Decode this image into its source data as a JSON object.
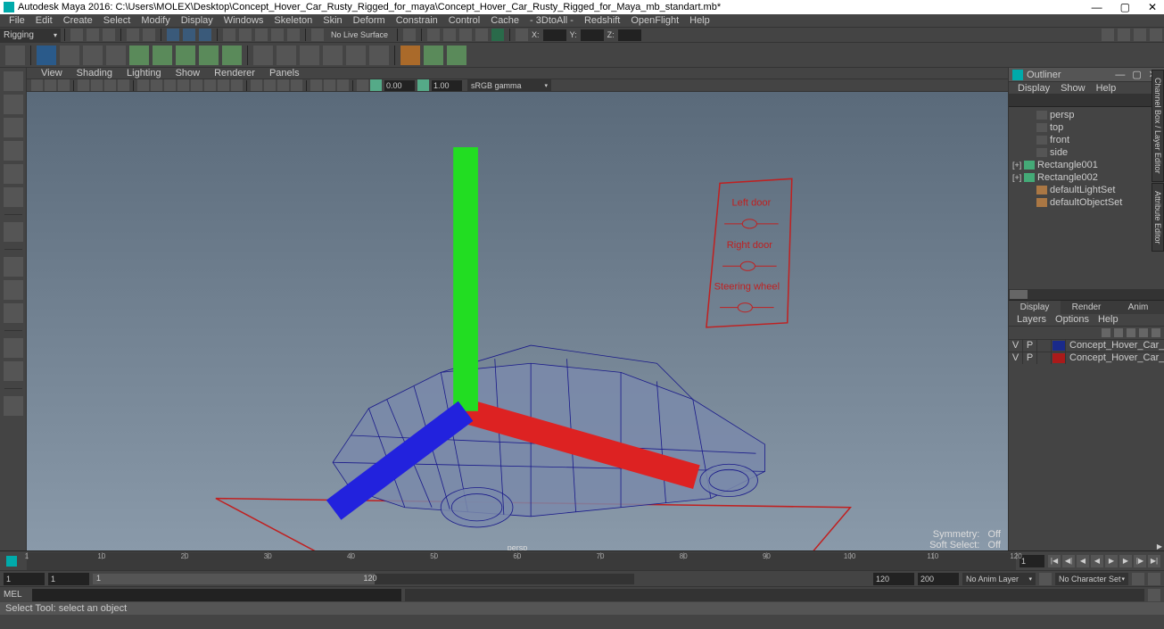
{
  "app": {
    "title": "Autodesk Maya 2016: C:\\Users\\MOLEX\\Desktop\\Concept_Hover_Car_Rusty_Rigged_for_maya\\Concept_Hover_Car_Rusty_Rigged_for_Maya_mb_standart.mb*"
  },
  "menubar": [
    "File",
    "Edit",
    "Create",
    "Select",
    "Modify",
    "Display",
    "Windows",
    "Skeleton",
    "Skin",
    "Deform",
    "Constrain",
    "Control",
    "Cache",
    "- 3DtoAll -",
    "Redshift",
    "OpenFlight",
    "Help"
  ],
  "shelf": {
    "mode": "Rigging",
    "status_label": "No Live Surface",
    "coords": {
      "x_label": "X:",
      "y_label": "Y:",
      "z_label": "Z:"
    }
  },
  "panel_menu": [
    "View",
    "Shading",
    "Lighting",
    "Show",
    "Renderer",
    "Panels"
  ],
  "panel": {
    "field1": "0.00",
    "field2": "1.00",
    "colorspace": "sRGB gamma"
  },
  "viewport": {
    "camera": "persp",
    "symmetry_label": "Symmetry:",
    "symmetry_value": "Off",
    "softsel_label": "Soft Select:",
    "softsel_value": "Off",
    "control_labels": [
      "Left door",
      "Right door",
      "Steering wheel"
    ]
  },
  "outliner": {
    "title": "Outliner",
    "menu": [
      "Display",
      "Show",
      "Help"
    ],
    "items": [
      {
        "type": "cam",
        "label": "persp",
        "indent": 1
      },
      {
        "type": "cam",
        "label": "top",
        "indent": 1
      },
      {
        "type": "cam",
        "label": "front",
        "indent": 1
      },
      {
        "type": "cam",
        "label": "side",
        "indent": 1
      },
      {
        "type": "obj",
        "label": "Rectangle001",
        "indent": 0,
        "expand": "+"
      },
      {
        "type": "obj",
        "label": "Rectangle002",
        "indent": 0,
        "expand": "+"
      },
      {
        "type": "set",
        "label": "defaultLightSet",
        "indent": 1
      },
      {
        "type": "set",
        "label": "defaultObjectSet",
        "indent": 1
      }
    ]
  },
  "display_panel": {
    "tabs": [
      "Display",
      "Render",
      "Anim"
    ],
    "active_tab": 0,
    "menu": [
      "Layers",
      "Options",
      "Help"
    ],
    "layers": [
      {
        "v": "V",
        "p": "P",
        "color": "#1a2a8a",
        "name": "Concept_Hover_Car_Rusty_"
      },
      {
        "v": "V",
        "p": "P",
        "color": "#aa1a1a",
        "name": "Concept_Hover_Car_Rusty_"
      }
    ]
  },
  "side_tabs": [
    "Channel Box / Layer Editor",
    "Attribute Editor"
  ],
  "timeline": {
    "current_frame": "1",
    "ticks": [
      1,
      10,
      20,
      30,
      40,
      50,
      60,
      70,
      80,
      90,
      100,
      110,
      120
    ]
  },
  "range": {
    "start_outer": "1",
    "start_inner": "1",
    "end_inner": "120",
    "end_outer": "120",
    "far_end1": "120",
    "far_end2": "200",
    "anim_layer": "No Anim Layer",
    "char_set": "No Character Set"
  },
  "cmdline": {
    "label": "MEL"
  },
  "helpline": {
    "text": "Select Tool: select an object"
  }
}
